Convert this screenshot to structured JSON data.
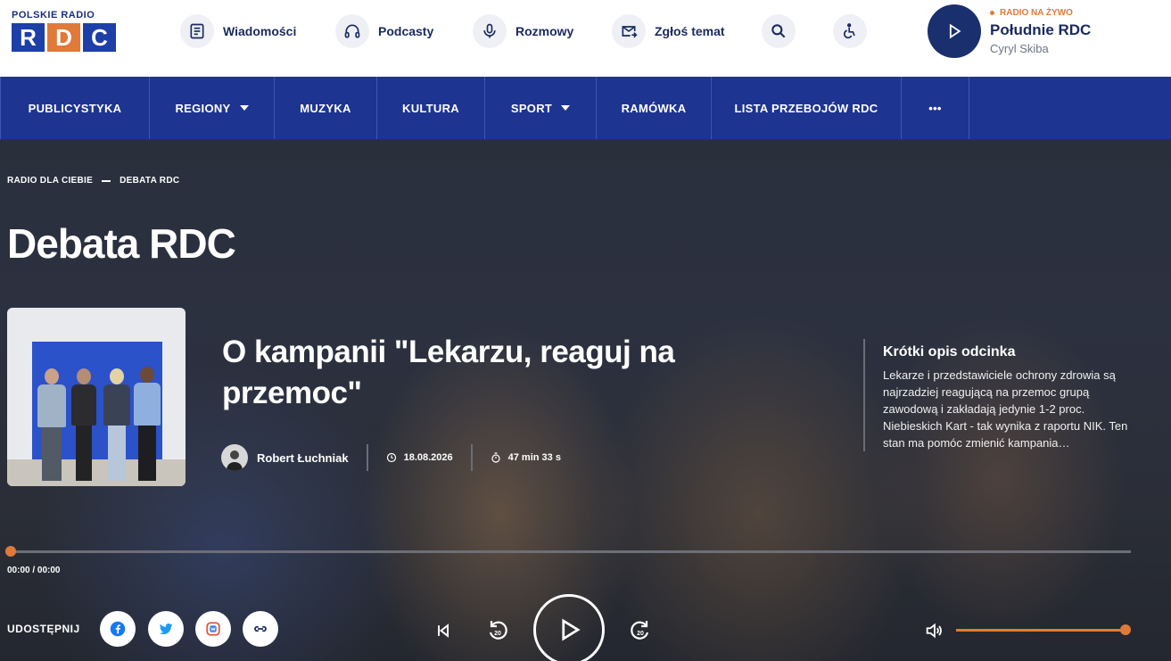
{
  "logo": {
    "top_text": "POLSKIE RADIO",
    "letters": [
      "R",
      "D",
      "C"
    ]
  },
  "top_nav": [
    {
      "label": "Wiadomości",
      "icon": "document-icon"
    },
    {
      "label": "Podcasty",
      "icon": "headphones-icon"
    },
    {
      "label": "Rozmowy",
      "icon": "microphone-icon"
    },
    {
      "label": "Zgłoś temat",
      "icon": "mail-icon"
    }
  ],
  "live": {
    "badge": "RADIO NA ŻYWO",
    "station": "Południe RDC",
    "host": "Cyryl Skiba"
  },
  "main_nav": [
    {
      "label": "PUBLICYSTYKA",
      "dropdown": false
    },
    {
      "label": "REGIONY",
      "dropdown": true
    },
    {
      "label": "MUZYKA",
      "dropdown": false
    },
    {
      "label": "KULTURA",
      "dropdown": false
    },
    {
      "label": "SPORT",
      "dropdown": true
    },
    {
      "label": "RAMÓWKA",
      "dropdown": false
    },
    {
      "label": "LISTA PRZEBOJÓW RDC",
      "dropdown": false
    },
    {
      "label": "•••",
      "dropdown": false
    }
  ],
  "breadcrumb": [
    "RADIO DLA CIEBIE",
    "DEBATA RDC"
  ],
  "page_title": "Debata RDC",
  "episode": {
    "title": "O kampanii \"Lekarzu, reaguj na przemoc\"",
    "author": "Robert Łuchniak",
    "date": "18.08.2026",
    "duration": "47 min 33 s"
  },
  "description": {
    "title": "Krótki opis odcinka",
    "text": "Lekarze i przedstawiciele ochrony zdrowia są najrzadziej reagującą na przemoc grupą zawodową i zakładają jedynie 1-2 proc. Niebieskich Kart - tak wynika z raportu NIK. Ten stan ma pomóc zmienić kampania…"
  },
  "player": {
    "time": "00:00 / 00:00",
    "progress": 0,
    "volume": 1.0,
    "skip_back": "20",
    "skip_forward": "20"
  },
  "share": {
    "label": "UDOSTĘPNIJ"
  },
  "colors": {
    "brand_blue": "#1d3491",
    "accent_orange": "#e07a3a",
    "navy": "#1a2a5e"
  }
}
